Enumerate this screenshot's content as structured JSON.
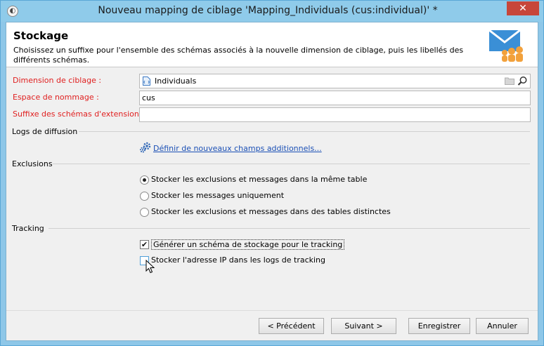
{
  "window": {
    "title": "Nouveau mapping de ciblage 'Mapping_Individuals (cus:individual)' *",
    "close_label": "✕"
  },
  "header": {
    "title": "Stockage",
    "description": "Choisissez un suffixe pour l'ensemble des schémas associés à la nouvelle dimension de ciblage, puis les libellés des différents schémas."
  },
  "form": {
    "dimension_label": "Dimension de ciblage :",
    "dimension_value": "Individuals",
    "namespace_label": "Espace de nommage :",
    "namespace_value": "cus",
    "suffix_label": "Suffixe des schémas d'extension :",
    "suffix_value": ""
  },
  "logs": {
    "section_label": "Logs de diffusion",
    "link_label": "Définir de nouveaux champs additionnels..."
  },
  "exclusions": {
    "section_label": "Exclusions",
    "options": [
      {
        "label": "Stocker les exclusions et messages dans la même table",
        "checked": true
      },
      {
        "label": "Stocker les messages uniquement",
        "checked": false
      },
      {
        "label": "Stocker les exclusions et messages dans des tables distinctes",
        "checked": false
      }
    ]
  },
  "tracking": {
    "section_label": "Tracking",
    "generate_label": "Générer un schéma de stockage pour le tracking",
    "generate_checked": true,
    "ip_label": "Stocker l'adresse IP dans les logs de tracking",
    "ip_checked": false
  },
  "buttons": {
    "previous": "< Précédent",
    "next": "Suivant >",
    "save": "Enregistrer",
    "cancel": "Annuler"
  },
  "colors": {
    "required_label": "#e02020",
    "link": "#1a4fb5",
    "titlebar": "#8fcbea",
    "close_button": "#c7463a"
  }
}
